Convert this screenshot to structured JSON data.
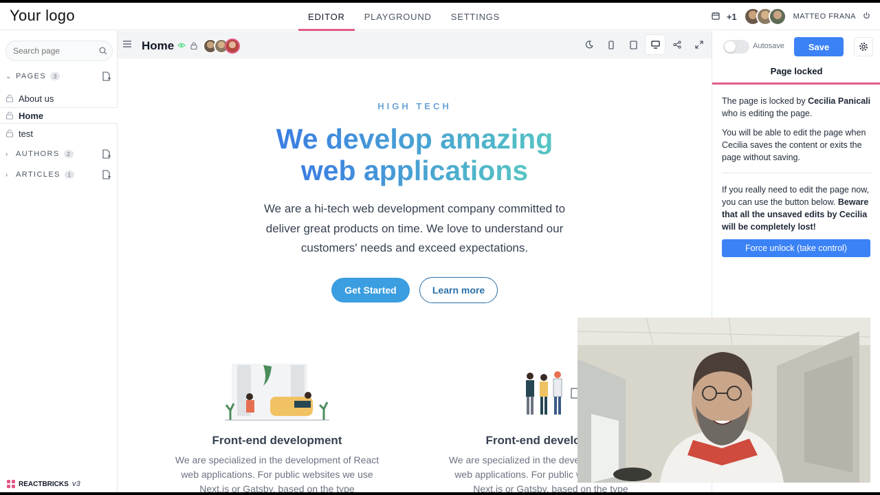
{
  "topnav": {
    "logo": "Your logo",
    "tabs": [
      {
        "label": "EDITOR",
        "active": true
      },
      {
        "label": "PLAYGROUND",
        "active": false
      },
      {
        "label": "SETTINGS",
        "active": false
      }
    ],
    "extra_users": "+1",
    "user_name": "MATTEO FRANA"
  },
  "sidebar": {
    "search_placeholder": "Search page",
    "sections": [
      {
        "label": "PAGES",
        "count": "3",
        "expanded": true
      },
      {
        "label": "AUTHORS",
        "count": "2",
        "expanded": false
      },
      {
        "label": "ARTICLES",
        "count": "1",
        "expanded": false
      }
    ],
    "pages": [
      {
        "label": "About us",
        "active": false
      },
      {
        "label": "Home",
        "active": true
      },
      {
        "label": "test",
        "active": false
      }
    ],
    "brand": "REACTBRICKS",
    "brand_version": "v3"
  },
  "toolbar": {
    "page_title": "Home"
  },
  "content": {
    "kicker": "HIGH TECH",
    "headline_line1": "We develop amazing",
    "headline_line2": "web applications",
    "lead": "We are a hi-tech web development company committed to deliver great products on time. We love to understand our customers' needs and exceed expectations.",
    "primary_cta": "Get Started",
    "secondary_cta": "Learn more",
    "features": [
      {
        "title": "Front-end development",
        "text": "We are specialized in the development of React web applications. For public websites we use Next.js or Gatsby, based on the type"
      },
      {
        "title": "Front-end development",
        "text": "We are specialized in the development of React web applications. For public websites we use Next.js or Gatsby, based on the type"
      }
    ]
  },
  "rpanel": {
    "autosave_label": "Autosave",
    "save_label": "Save",
    "locked_title": "Page locked",
    "locked_by_prefix": "The page is locked by ",
    "locked_by_name": "Cecilia Panicali",
    "locked_by_suffix": " who is editing the page.",
    "able_text": "You will be able to edit the page when Cecilia saves the content or exits the page without saving.",
    "force_intro": "If you really need to edit the page now, you can use the button below.",
    "force_warning": "Beware that all the unsaved edits by Cecilia will be completely lost!",
    "force_button": "Force unlock (take control)"
  },
  "colors": {
    "accent": "#e25b87",
    "primary": "#3b82f6",
    "gradient_start": "#3b7de3",
    "gradient_end": "#56c5c3"
  }
}
